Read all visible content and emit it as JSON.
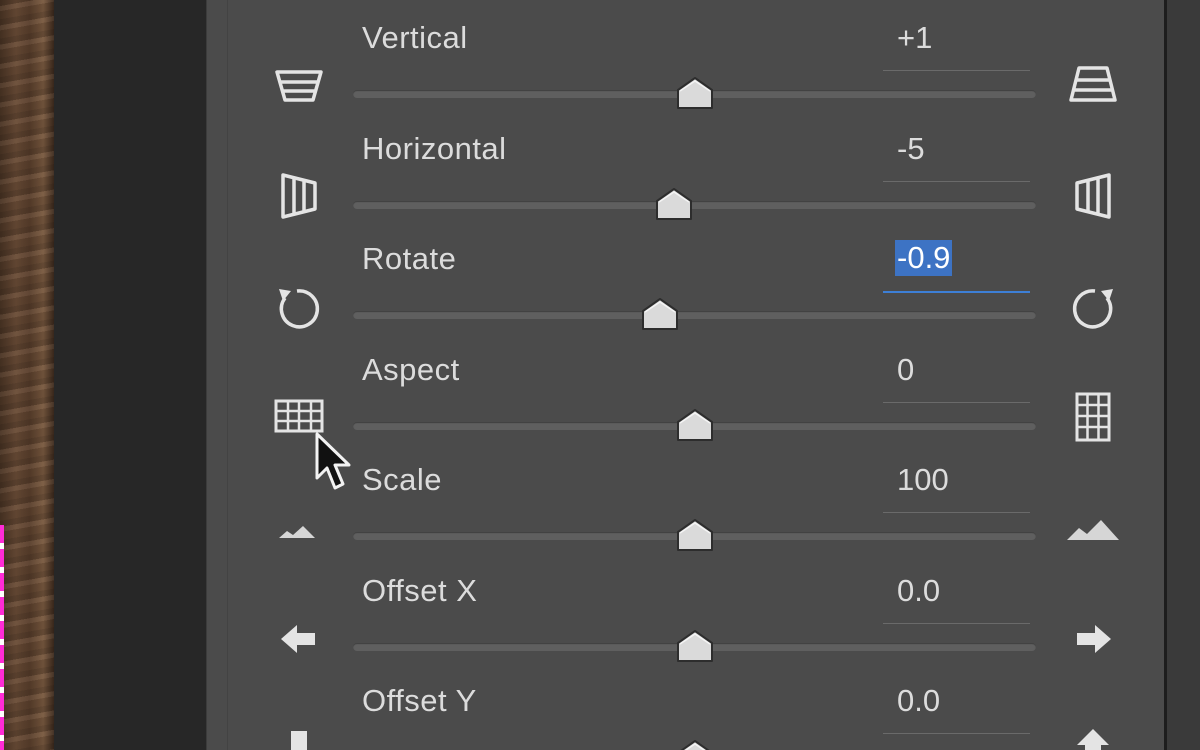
{
  "rows": [
    {
      "id": "vertical",
      "label": "Vertical",
      "value": "+1",
      "selected": false,
      "position": 0.5,
      "left_icon": "perspective-vertical-narrow-bottom-icon",
      "right_icon": "perspective-vertical-wide-bottom-icon"
    },
    {
      "id": "horizontal",
      "label": "Horizontal",
      "value": "-5",
      "selected": false,
      "position": 0.47,
      "left_icon": "perspective-horizontal-narrow-right-icon",
      "right_icon": "perspective-horizontal-narrow-left-icon"
    },
    {
      "id": "rotate",
      "label": "Rotate",
      "value": "-0.9",
      "selected": true,
      "position": 0.45,
      "left_icon": "rotate-counterclockwise-icon",
      "right_icon": "rotate-clockwise-icon"
    },
    {
      "id": "aspect",
      "label": "Aspect",
      "value": "0",
      "selected": false,
      "position": 0.5,
      "left_icon": "aspect-wide-grid-icon",
      "right_icon": "aspect-tall-grid-icon"
    },
    {
      "id": "scale",
      "label": "Scale",
      "value": "100",
      "selected": false,
      "position": 0.5,
      "left_icon": "scale-small-mountains-icon",
      "right_icon": "scale-large-mountains-icon"
    },
    {
      "id": "offset-x",
      "label": "Offset X",
      "value": "0.0",
      "selected": false,
      "position": 0.5,
      "left_icon": "arrow-left-icon",
      "right_icon": "arrow-right-icon"
    },
    {
      "id": "offset-y",
      "label": "Offset Y",
      "value": "0.0",
      "selected": false,
      "position": 0.5,
      "left_icon": "arrow-down-icon",
      "right_icon": "arrow-up-icon"
    }
  ],
  "colors": {
    "panel": "#4b4b4b",
    "text": "#dcdcdc",
    "selection": "#3d73c4",
    "active_underline": "#3d7fd6",
    "thumb": "#d9d9d9",
    "crop_guide": "#ff2bd6"
  }
}
